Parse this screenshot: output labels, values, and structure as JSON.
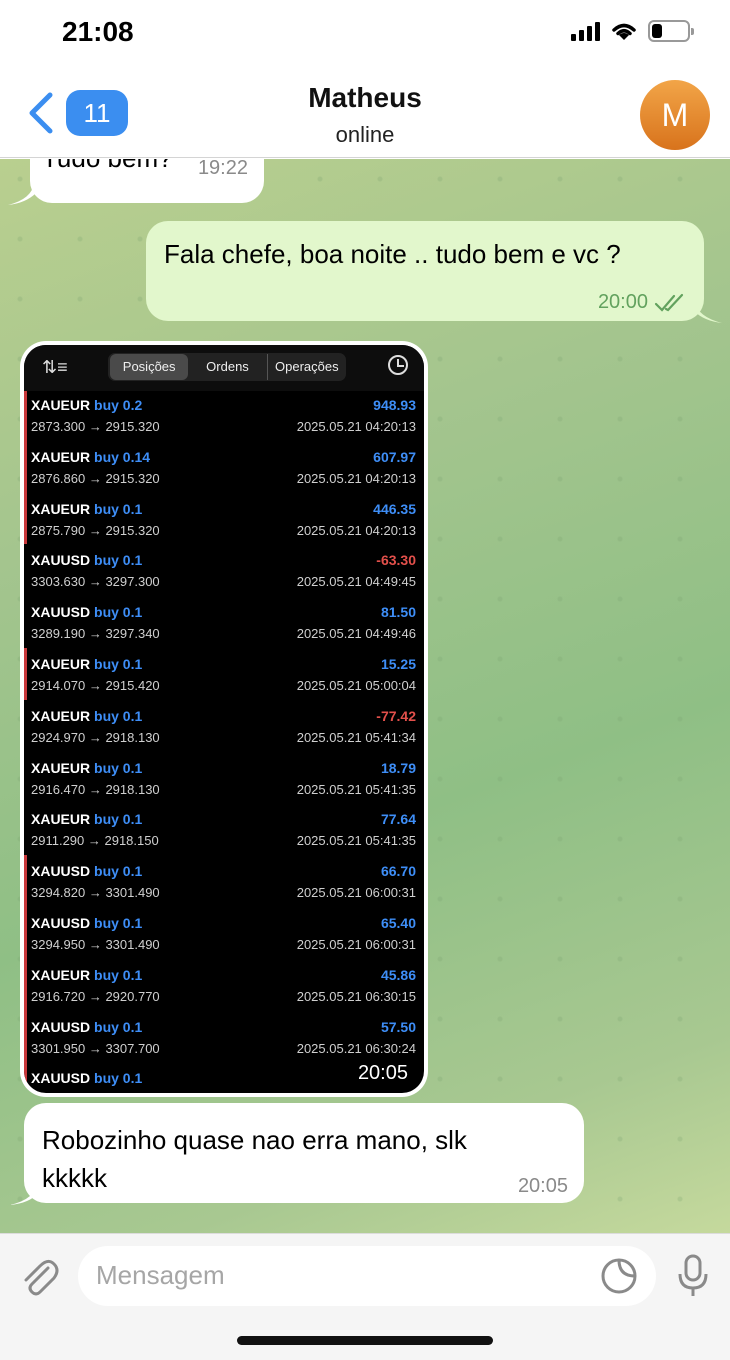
{
  "status_bar": {
    "time": "21:08",
    "battery_level": 0.3
  },
  "header": {
    "back_count": "11",
    "title": "Matheus",
    "subtitle": "online",
    "avatar_letter": "M",
    "avatar_color": "#e4872a",
    "accent": "#3b8ef0"
  },
  "messages": [
    {
      "direction": "in",
      "text": "Tudo bem?",
      "time": "19:22"
    },
    {
      "direction": "out",
      "text": "Fala chefe, boa noite .. tudo bem e vc ?",
      "time": "20:00",
      "status_icon": "double-check-icon"
    },
    {
      "direction": "in",
      "type": "image",
      "time": "20:05"
    },
    {
      "direction": "in",
      "text": "Robozinho quase nao erra mano, slk kkkkk",
      "time": "20:05"
    }
  ],
  "screenshot": {
    "tabs": [
      "Posições",
      "Ordens",
      "Operações"
    ],
    "active_tab": "Posições",
    "icons": [
      "sort-icon",
      "clock-icon"
    ],
    "trades": [
      {
        "symbol": "XAUEUR",
        "side": "buy",
        "volume": "0.2",
        "prices": "2873.300 → 2915.320",
        "profit": "948.93",
        "time": "2025.05.21 04:20:13"
      },
      {
        "symbol": "XAUEUR",
        "side": "buy",
        "volume": "0.14",
        "prices": "2876.860 → 2915.320",
        "profit": "607.97",
        "time": "2025.05.21 04:20:13"
      },
      {
        "symbol": "XAUEUR",
        "side": "buy",
        "volume": "0.1",
        "prices": "2875.790 → 2915.320",
        "profit": "446.35",
        "time": "2025.05.21 04:20:13"
      },
      {
        "symbol": "XAUUSD",
        "side": "buy",
        "volume": "0.1",
        "prices": "3303.630 → 3297.300",
        "profit": "-63.30",
        "time": "2025.05.21 04:49:45"
      },
      {
        "symbol": "XAUUSD",
        "side": "buy",
        "volume": "0.1",
        "prices": "3289.190 → 3297.340",
        "profit": "81.50",
        "time": "2025.05.21 04:49:46"
      },
      {
        "symbol": "XAUEUR",
        "side": "buy",
        "volume": "0.1",
        "prices": "2914.070 → 2915.420",
        "profit": "15.25",
        "time": "2025.05.21 05:00:04"
      },
      {
        "symbol": "XAUEUR",
        "side": "buy",
        "volume": "0.1",
        "prices": "2924.970 → 2918.130",
        "profit": "-77.42",
        "time": "2025.05.21 05:41:34"
      },
      {
        "symbol": "XAUEUR",
        "side": "buy",
        "volume": "0.1",
        "prices": "2916.470 → 2918.130",
        "profit": "18.79",
        "time": "2025.05.21 05:41:35"
      },
      {
        "symbol": "XAUEUR",
        "side": "buy",
        "volume": "0.1",
        "prices": "2911.290 → 2918.150",
        "profit": "77.64",
        "time": "2025.05.21 05:41:35"
      },
      {
        "symbol": "XAUUSD",
        "side": "buy",
        "volume": "0.1",
        "prices": "3294.820 → 3301.490",
        "profit": "66.70",
        "time": "2025.05.21 06:00:31"
      },
      {
        "symbol": "XAUUSD",
        "side": "buy",
        "volume": "0.1",
        "prices": "3294.950 → 3301.490",
        "profit": "65.40",
        "time": "2025.05.21 06:00:31"
      },
      {
        "symbol": "XAUEUR",
        "side": "buy",
        "volume": "0.1",
        "prices": "2916.720 → 2920.770",
        "profit": "45.86",
        "time": "2025.05.21 06:30:15"
      },
      {
        "symbol": "XAUUSD",
        "side": "buy",
        "volume": "0.1",
        "prices": "3301.950 → 3307.700",
        "profit": "57.50",
        "time": "2025.05.21 06:30:24"
      }
    ],
    "partial_bottom": {
      "symbol": "XAUUSD",
      "side": "buy",
      "volume": "0.1"
    }
  },
  "input": {
    "placeholder": "Mensagem"
  },
  "icons": {
    "back": "chevron-left-icon",
    "attach": "paperclip-icon",
    "sticker": "sticker-icon",
    "mic": "microphone-icon"
  }
}
